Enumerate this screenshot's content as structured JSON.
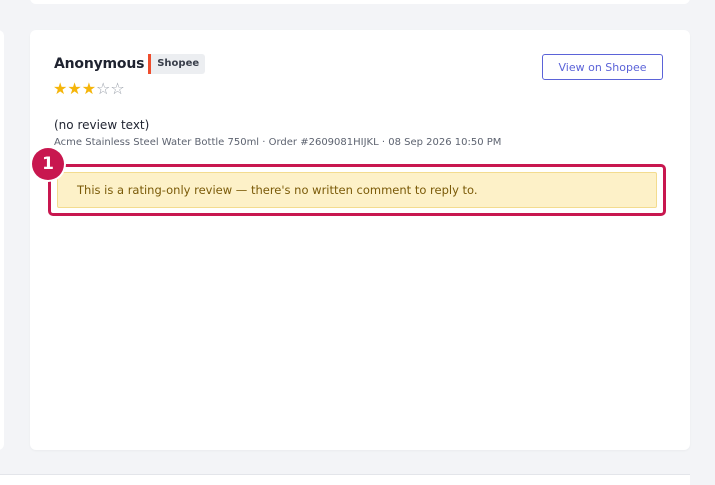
{
  "review": {
    "reviewer_name": "Anonymous",
    "platform_badge": "Shopee",
    "rating": 3,
    "rating_max": 5,
    "star_filled": "★",
    "star_empty": "☆",
    "review_text": "(no review text)",
    "meta": "Acme Stainless Steel Water Bottle 750ml · Order #2609081HIJKL · 08 Sep 2026 10:50 PM",
    "view_button_label": "View on Shopee",
    "notice": "This is a rating-only review — there's no written comment to reply to."
  },
  "annotation": {
    "step_number": "1"
  },
  "colors": {
    "accent": "#5b63d8",
    "star": "#f5b50a",
    "highlight": "#c8174f",
    "shopee": "#ee4d2d",
    "notice_bg": "#fdf1c8",
    "notice_text": "#7a5a08"
  }
}
